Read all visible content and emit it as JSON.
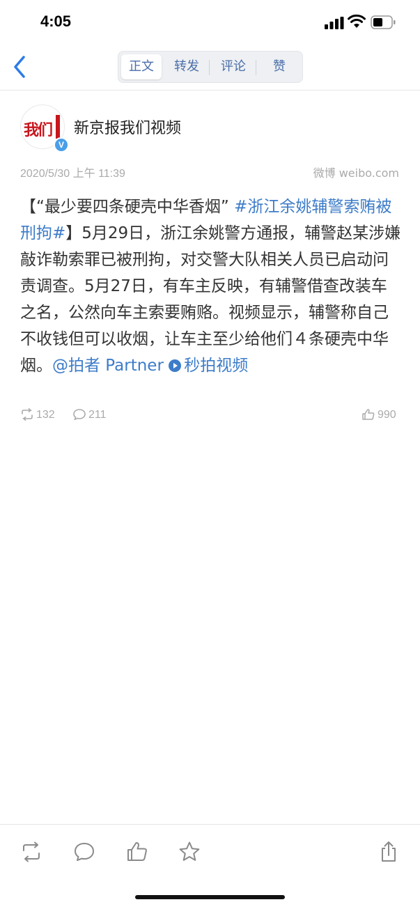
{
  "status": {
    "time": "4:05"
  },
  "nav": {
    "tabs": [
      {
        "label": "正文",
        "active": true
      },
      {
        "label": "转发",
        "active": false
      },
      {
        "label": "评论",
        "active": false
      },
      {
        "label": "赞",
        "active": false
      }
    ]
  },
  "post": {
    "author": "新京报我们视频",
    "avatar_text": "我们",
    "verified_mark": "V",
    "timestamp": "2020/5/30 上午 11:39",
    "source": "微博 weibo.com",
    "text": {
      "p1": "【“最少要四条硬壳中华香烟” ",
      "hashtag": "#浙江余姚辅警索贿被刑拘#",
      "p2": "】5月29日，浙江余姚警方通报，辅警赵某涉嫌敲诈勒索罪已被刑拘，对交警大队相关人员已启动问责调查。5月27日，有车主反映，有辅警借查改装车之名，公然向车主索要贿赂。视频显示，辅警称自己不收钱但可以收烟，让车主至少给他们４条硬壳中华烟。",
      "mention": "@拍者 Partner",
      "video_link": "秒拍视频"
    },
    "stats": {
      "reposts": "132",
      "comments": "211",
      "likes": "990"
    }
  },
  "colors": {
    "link": "#3d7cc9",
    "accent": "#4a6ea9",
    "verified": "#4a9fe8"
  }
}
